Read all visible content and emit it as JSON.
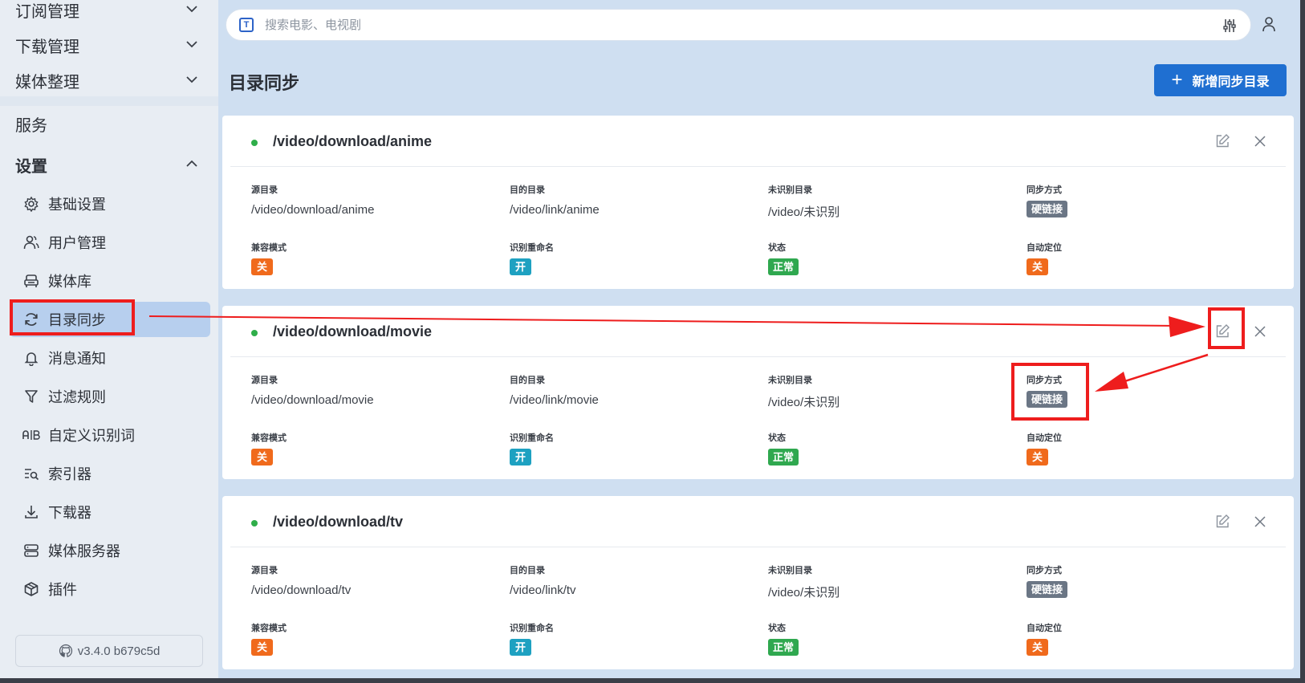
{
  "sidebar": {
    "top_menus": [
      {
        "label": "订阅管理"
      },
      {
        "label": "下载管理"
      },
      {
        "label": "媒体整理"
      }
    ],
    "services_label": "服务",
    "settings_label": "设置",
    "items": [
      {
        "label": "基础设置",
        "icon": "gear-icon"
      },
      {
        "label": "用户管理",
        "icon": "users-icon"
      },
      {
        "label": "媒体库",
        "icon": "sofa-icon"
      },
      {
        "label": "目录同步",
        "icon": "sync-icon",
        "active": true
      },
      {
        "label": "消息通知",
        "icon": "bell-icon"
      },
      {
        "label": "过滤规则",
        "icon": "filter-icon"
      },
      {
        "label": "自定义识别词",
        "icon": "ab-icon"
      },
      {
        "label": "索引器",
        "icon": "list-search-icon"
      },
      {
        "label": "下载器",
        "icon": "download-icon"
      },
      {
        "label": "媒体服务器",
        "icon": "server-icon"
      },
      {
        "label": "插件",
        "icon": "cube-icon"
      }
    ],
    "version": "v3.4.0 b679c5d"
  },
  "search": {
    "placeholder": "搜索电影、电视剧",
    "prefix_icon": "t-icon"
  },
  "page": {
    "title": "目录同步",
    "add_button_label": "新增同步目录"
  },
  "field_labels": {
    "source": "源目录",
    "dest": "目的目录",
    "unrecognized": "未识别目录",
    "sync_mode": "同步方式",
    "compat_mode": "兼容模式",
    "rename": "识别重命名",
    "status": "状态",
    "auto_locate": "自动定位"
  },
  "cards": [
    {
      "title": "/video/download/anime",
      "source": "/video/download/anime",
      "dest": "/video/link/anime",
      "unrecognized": "/video/未识别",
      "sync_mode": "硬链接",
      "compat_mode": "关",
      "rename": "开",
      "status": "正常",
      "auto_locate": "关"
    },
    {
      "title": "/video/download/movie",
      "source": "/video/download/movie",
      "dest": "/video/link/movie",
      "unrecognized": "/video/未识别",
      "sync_mode": "硬链接",
      "compat_mode": "关",
      "rename": "开",
      "status": "正常",
      "auto_locate": "关"
    },
    {
      "title": "/video/download/tv",
      "source": "/video/download/tv",
      "dest": "/video/link/tv",
      "unrecognized": "/video/未识别",
      "sync_mode": "硬链接",
      "compat_mode": "关",
      "rename": "开",
      "status": "正常",
      "auto_locate": "关"
    }
  ],
  "colors": {
    "accent": "#1f6fd1",
    "annotation": "#ee1d1d",
    "status_dot": "#2fae4a",
    "chip_off": "#f06a1c",
    "chip_on": "#1ea1c1",
    "chip_normal": "#2fa84f",
    "chip_mode": "#6b7685"
  }
}
